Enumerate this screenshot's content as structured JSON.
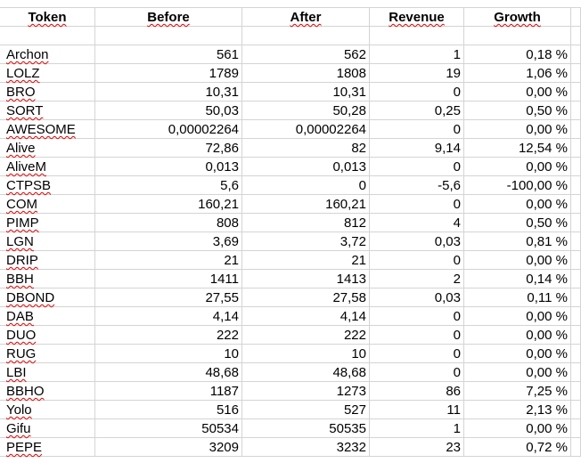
{
  "columns": [
    "Token",
    "Before",
    "After",
    "Revenue",
    "Growth"
  ],
  "rows": [
    [
      "Archon",
      "561",
      "562",
      "1",
      "0,18 %"
    ],
    [
      "LOLZ",
      "1789",
      "1808",
      "19",
      "1,06 %"
    ],
    [
      "BRO",
      "10,31",
      "10,31",
      "0",
      "0,00 %"
    ],
    [
      "SORT",
      "50,03",
      "50,28",
      "0,25",
      "0,50 %"
    ],
    [
      "AWESOME",
      "0,00002264",
      "0,00002264",
      "0",
      "0,00 %"
    ],
    [
      "Alive",
      "72,86",
      "82",
      "9,14",
      "12,54 %"
    ],
    [
      "AliveM",
      "0,013",
      "0,013",
      "0",
      "0,00 %"
    ],
    [
      "CTPSB",
      "5,6",
      "0",
      "-5,6",
      "-100,00 %"
    ],
    [
      "COM",
      "160,21",
      "160,21",
      "0",
      "0,00 %"
    ],
    [
      "PIMP",
      "808",
      "812",
      "4",
      "0,50 %"
    ],
    [
      "LGN",
      "3,69",
      "3,72",
      "0,03",
      "0,81 %"
    ],
    [
      "DRIP",
      "21",
      "21",
      "0",
      "0,00 %"
    ],
    [
      "BBH",
      "1411",
      "1413",
      "2",
      "0,14 %"
    ],
    [
      "DBOND",
      "27,55",
      "27,58",
      "0,03",
      "0,11 %"
    ],
    [
      "DAB",
      "4,14",
      "4,14",
      "0",
      "0,00 %"
    ],
    [
      "DUO",
      "222",
      "222",
      "0",
      "0,00 %"
    ],
    [
      "RUG",
      "10",
      "10",
      "0",
      "0,00 %"
    ],
    [
      "LBI",
      "48,68",
      "48,68",
      "0",
      "0,00 %"
    ],
    [
      "BBHO",
      "1187",
      "1273",
      "86",
      "7,25 %"
    ],
    [
      "Yolo",
      "516",
      "527",
      "11",
      "2,13 %"
    ],
    [
      "Gifu",
      "50534",
      "50535",
      "1",
      "0,00 %"
    ],
    [
      "PEPE",
      "3209",
      "3232",
      "23",
      "0,72 %"
    ]
  ],
  "colors": {
    "grid": "#d4d4d4",
    "spellcheck": "#e00000"
  }
}
